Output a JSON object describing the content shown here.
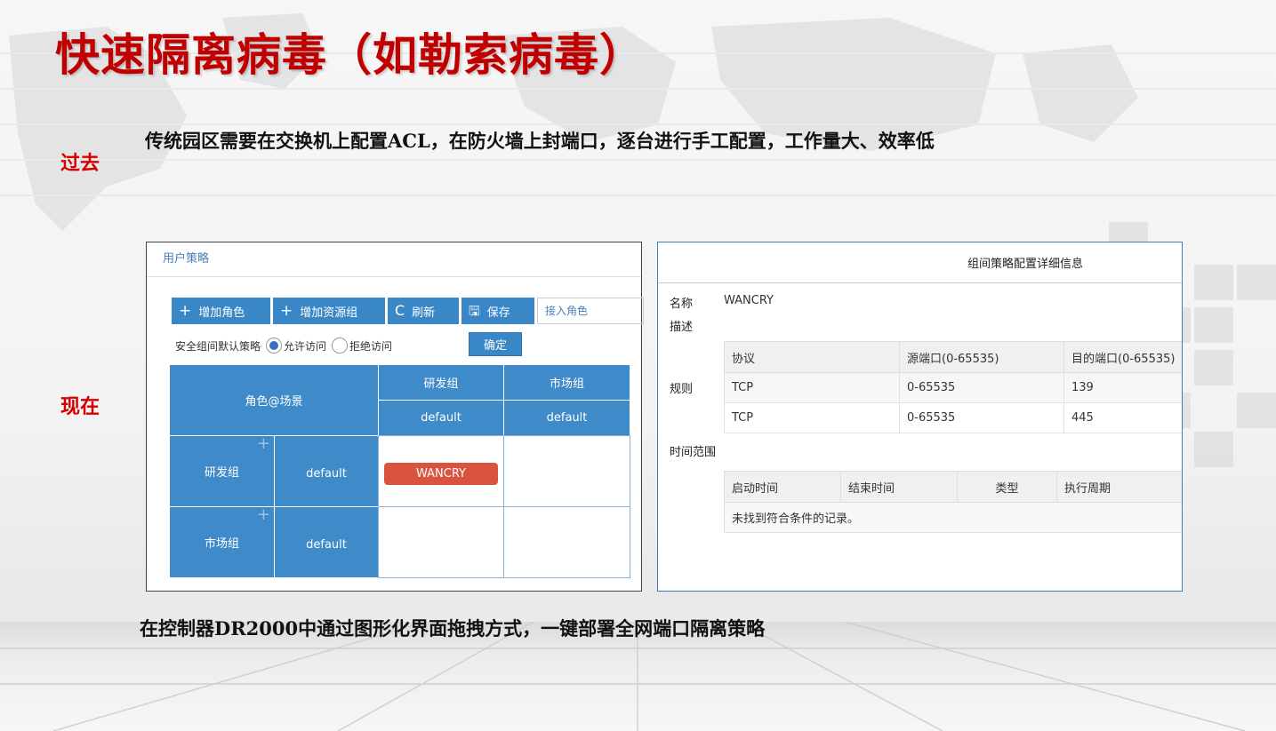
{
  "title": "快速隔离病毒（如勒索病毒）",
  "past": {
    "label": "过去",
    "text": "传统园区需要在交换机上配置ACL，在防火墙上封端口，逐台进行手工配置，工作量大、效率低"
  },
  "now": {
    "label": "现在"
  },
  "footer_text": "在控制器DR2000中通过图形化界面拖拽方式，一键部署全网端口隔离策略",
  "left_panel": {
    "header": "用户策略",
    "toolbar": [
      {
        "icon": "plus-icon",
        "glyph": "+",
        "label": "增加角色"
      },
      {
        "icon": "plus-icon",
        "glyph": "+",
        "label": "增加资源组"
      },
      {
        "icon": "refresh-icon",
        "glyph": "C",
        "label": "刷新"
      },
      {
        "icon": "save-icon",
        "glyph": "🖫",
        "label": "保存"
      }
    ],
    "input_placeholder": "接入角色",
    "policy_label": "安全组间默认策略",
    "radio_allow": "允许访问",
    "radio_deny": "拒绝访问",
    "radio_selected": "允许访问",
    "confirm_label": "确定",
    "matrix": {
      "corner": "角色@场景",
      "col_groups": [
        "研发组",
        "市场组"
      ],
      "col_scenes": [
        "default",
        "default"
      ],
      "rows": [
        {
          "group": "研发组",
          "scene": "default",
          "cells": [
            "WANCRY",
            ""
          ]
        },
        {
          "group": "市场组",
          "scene": "default",
          "cells": [
            "",
            ""
          ]
        }
      ]
    }
  },
  "right_panel": {
    "title": "组间策略配置详细信息",
    "name_label": "名称",
    "name_value": "WANCRY",
    "desc_label": "描述",
    "rules_label": "规则",
    "rules_headers": [
      "协议",
      "源端口(0-65535)",
      "目的端口(0-65535)"
    ],
    "rules": [
      [
        "TCP",
        "0-65535",
        "139"
      ],
      [
        "TCP",
        "0-65535",
        "445"
      ]
    ],
    "time_label": "时间范围",
    "time_headers": [
      "启动时间",
      "结束时间",
      "类型",
      "执行周期"
    ],
    "time_empty": "未找到符合条件的记录。"
  },
  "colors": {
    "title": "#c00000",
    "accent_blue": "#3f8bc9",
    "tag_red": "#d9533f"
  }
}
